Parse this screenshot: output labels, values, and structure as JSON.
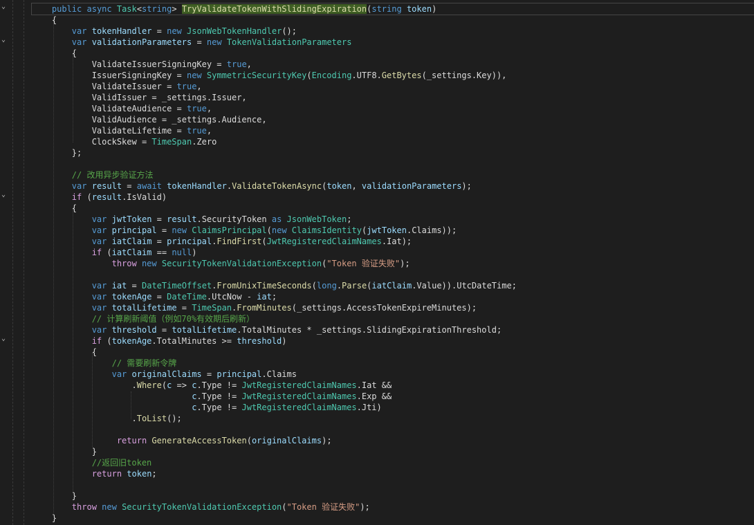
{
  "editor": {
    "language": "C#",
    "theme_colors": {
      "background": "#1e1e1e",
      "keyword": "#569cd6",
      "type": "#4ec9b0",
      "method": "#dcdcaa",
      "comment": "#57a64a",
      "string": "#d69d85",
      "identifier": "#9cdcfe",
      "plain": "#dcdcdc",
      "highlight": "#3f5e24"
    },
    "highlighted_symbol": "TryValidateTokenWithSlidingExpiration",
    "lines": [
      [
        [
          "    ",
          "pl"
        ],
        [
          "public",
          "kw"
        ],
        [
          " ",
          "pl"
        ],
        [
          "async",
          "kw"
        ],
        [
          " ",
          "pl"
        ],
        [
          "Task",
          "ty"
        ],
        [
          "<",
          "pl"
        ],
        [
          "string",
          "kw"
        ],
        [
          "> ",
          "pl"
        ],
        [
          "TryValidateTokenWithSlidingExpiration",
          "hl"
        ],
        [
          "(",
          "pl"
        ],
        [
          "string",
          "kw"
        ],
        [
          " ",
          "pl"
        ],
        [
          "token",
          "id"
        ],
        [
          ")",
          "pl"
        ]
      ],
      [
        [
          "    {",
          "pl"
        ]
      ],
      [
        [
          "        ",
          "pl"
        ],
        [
          "var",
          "kw"
        ],
        [
          " ",
          "pl"
        ],
        [
          "tokenHandler",
          "id"
        ],
        [
          " = ",
          "pl"
        ],
        [
          "new",
          "kw"
        ],
        [
          " ",
          "pl"
        ],
        [
          "JsonWebTokenHandler",
          "ty"
        ],
        [
          "();",
          "pl"
        ]
      ],
      [
        [
          "        ",
          "pl"
        ],
        [
          "var",
          "kw"
        ],
        [
          " ",
          "pl"
        ],
        [
          "validationParameters",
          "id"
        ],
        [
          " = ",
          "pl"
        ],
        [
          "new",
          "kw"
        ],
        [
          " ",
          "pl"
        ],
        [
          "TokenValidationParameters",
          "ty"
        ]
      ],
      [
        [
          "        {",
          "pl"
        ]
      ],
      [
        [
          "            ValidateIssuerSigningKey = ",
          "pl"
        ],
        [
          "true",
          "kw"
        ],
        [
          ",",
          "pl"
        ]
      ],
      [
        [
          "            IssuerSigningKey = ",
          "pl"
        ],
        [
          "new",
          "kw"
        ],
        [
          " ",
          "pl"
        ],
        [
          "SymmetricSecurityKey",
          "ty"
        ],
        [
          "(",
          "pl"
        ],
        [
          "Encoding",
          "ty"
        ],
        [
          ".UTF8.",
          "pl"
        ],
        [
          "GetBytes",
          "fn"
        ],
        [
          "(_settings.Key)),",
          "pl"
        ]
      ],
      [
        [
          "            ValidateIssuer = ",
          "pl"
        ],
        [
          "true",
          "kw"
        ],
        [
          ",",
          "pl"
        ]
      ],
      [
        [
          "            ValidIssuer = _settings.Issuer,",
          "pl"
        ]
      ],
      [
        [
          "            ValidateAudience = ",
          "pl"
        ],
        [
          "true",
          "kw"
        ],
        [
          ",",
          "pl"
        ]
      ],
      [
        [
          "            ValidAudience = _settings.Audience,",
          "pl"
        ]
      ],
      [
        [
          "            ValidateLifetime = ",
          "pl"
        ],
        [
          "true",
          "kw"
        ],
        [
          ",",
          "pl"
        ]
      ],
      [
        [
          "            ClockSkew = ",
          "pl"
        ],
        [
          "TimeSpan",
          "ty"
        ],
        [
          ".Zero",
          "pl"
        ]
      ],
      [
        [
          "        };",
          "pl"
        ]
      ],
      [
        [
          "",
          "pl"
        ]
      ],
      [
        [
          "        ",
          "pl"
        ],
        [
          "// 改用异步验证方法",
          "cm"
        ]
      ],
      [
        [
          "        ",
          "pl"
        ],
        [
          "var",
          "kw"
        ],
        [
          " ",
          "pl"
        ],
        [
          "result",
          "id"
        ],
        [
          " = ",
          "pl"
        ],
        [
          "await",
          "kw"
        ],
        [
          " ",
          "pl"
        ],
        [
          "tokenHandler",
          "id"
        ],
        [
          ".",
          "pl"
        ],
        [
          "ValidateTokenAsync",
          "fn"
        ],
        [
          "(",
          "pl"
        ],
        [
          "token",
          "id"
        ],
        [
          ", ",
          "pl"
        ],
        [
          "validationParameters",
          "id"
        ],
        [
          ");",
          "pl"
        ]
      ],
      [
        [
          "        ",
          "pl"
        ],
        [
          "if",
          "kw2"
        ],
        [
          " (",
          "pl"
        ],
        [
          "result",
          "id"
        ],
        [
          ".IsValid)",
          "pl"
        ]
      ],
      [
        [
          "        {",
          "pl"
        ]
      ],
      [
        [
          "            ",
          "pl"
        ],
        [
          "var",
          "kw"
        ],
        [
          " ",
          "pl"
        ],
        [
          "jwtToken",
          "id"
        ],
        [
          " = ",
          "pl"
        ],
        [
          "result",
          "id"
        ],
        [
          ".SecurityToken ",
          "pl"
        ],
        [
          "as",
          "kw"
        ],
        [
          " ",
          "pl"
        ],
        [
          "JsonWebToken",
          "ty"
        ],
        [
          ";",
          "pl"
        ]
      ],
      [
        [
          "            ",
          "pl"
        ],
        [
          "var",
          "kw"
        ],
        [
          " ",
          "pl"
        ],
        [
          "principal",
          "id"
        ],
        [
          " = ",
          "pl"
        ],
        [
          "new",
          "kw"
        ],
        [
          " ",
          "pl"
        ],
        [
          "ClaimsPrincipal",
          "ty"
        ],
        [
          "(",
          "pl"
        ],
        [
          "new",
          "kw"
        ],
        [
          " ",
          "pl"
        ],
        [
          "ClaimsIdentity",
          "ty"
        ],
        [
          "(",
          "pl"
        ],
        [
          "jwtToken",
          "id"
        ],
        [
          ".Claims));",
          "pl"
        ]
      ],
      [
        [
          "            ",
          "pl"
        ],
        [
          "var",
          "kw"
        ],
        [
          " ",
          "pl"
        ],
        [
          "iatClaim",
          "id"
        ],
        [
          " = ",
          "pl"
        ],
        [
          "principal",
          "id"
        ],
        [
          ".",
          "pl"
        ],
        [
          "FindFirst",
          "fn"
        ],
        [
          "(",
          "pl"
        ],
        [
          "JwtRegisteredClaimNames",
          "ty"
        ],
        [
          ".Iat);",
          "pl"
        ]
      ],
      [
        [
          "            ",
          "pl"
        ],
        [
          "if",
          "kw2"
        ],
        [
          " (",
          "pl"
        ],
        [
          "iatClaim",
          "id"
        ],
        [
          " == ",
          "pl"
        ],
        [
          "null",
          "kw"
        ],
        [
          ")",
          "pl"
        ]
      ],
      [
        [
          "                ",
          "pl"
        ],
        [
          "throw",
          "kw2"
        ],
        [
          " ",
          "pl"
        ],
        [
          "new",
          "kw"
        ],
        [
          " ",
          "pl"
        ],
        [
          "SecurityTokenValidationException",
          "ty"
        ],
        [
          "(",
          "pl"
        ],
        [
          "\"Token 验证失败\"",
          "st"
        ],
        [
          ");",
          "pl"
        ]
      ],
      [
        [
          "",
          "pl"
        ]
      ],
      [
        [
          "            ",
          "pl"
        ],
        [
          "var",
          "kw"
        ],
        [
          " ",
          "pl"
        ],
        [
          "iat",
          "id"
        ],
        [
          " = ",
          "pl"
        ],
        [
          "DateTimeOffset",
          "ty"
        ],
        [
          ".",
          "pl"
        ],
        [
          "FromUnixTimeSeconds",
          "fn"
        ],
        [
          "(",
          "pl"
        ],
        [
          "long",
          "kw"
        ],
        [
          ".",
          "pl"
        ],
        [
          "Parse",
          "fn"
        ],
        [
          "(",
          "pl"
        ],
        [
          "iatClaim",
          "id"
        ],
        [
          ".Value)).UtcDateTime;",
          "pl"
        ]
      ],
      [
        [
          "            ",
          "pl"
        ],
        [
          "var",
          "kw"
        ],
        [
          " ",
          "pl"
        ],
        [
          "tokenAge",
          "id"
        ],
        [
          " = ",
          "pl"
        ],
        [
          "DateTime",
          "ty"
        ],
        [
          ".UtcNow - ",
          "pl"
        ],
        [
          "iat",
          "id"
        ],
        [
          ";",
          "pl"
        ]
      ],
      [
        [
          "            ",
          "pl"
        ],
        [
          "var",
          "kw"
        ],
        [
          " ",
          "pl"
        ],
        [
          "totalLifetime",
          "id"
        ],
        [
          " = ",
          "pl"
        ],
        [
          "TimeSpan",
          "ty"
        ],
        [
          ".",
          "pl"
        ],
        [
          "FromMinutes",
          "fn"
        ],
        [
          "(_settings.AccessTokenExpireMinutes);",
          "pl"
        ]
      ],
      [
        [
          "            ",
          "pl"
        ],
        [
          "// 计算刷新阈值（例如70%有效期后刷新）",
          "cm"
        ]
      ],
      [
        [
          "            ",
          "pl"
        ],
        [
          "var",
          "kw"
        ],
        [
          " ",
          "pl"
        ],
        [
          "threshold",
          "id"
        ],
        [
          " = ",
          "pl"
        ],
        [
          "totalLifetime",
          "id"
        ],
        [
          ".TotalMinutes * _settings.SlidingExpirationThreshold;",
          "pl"
        ]
      ],
      [
        [
          "            ",
          "pl"
        ],
        [
          "if",
          "kw2"
        ],
        [
          " (",
          "pl"
        ],
        [
          "tokenAge",
          "id"
        ],
        [
          ".TotalMinutes >= ",
          "pl"
        ],
        [
          "threshold",
          "id"
        ],
        [
          ")",
          "pl"
        ]
      ],
      [
        [
          "            {",
          "pl"
        ]
      ],
      [
        [
          "                ",
          "pl"
        ],
        [
          "// 需要刷新令牌",
          "cm"
        ]
      ],
      [
        [
          "                ",
          "pl"
        ],
        [
          "var",
          "kw"
        ],
        [
          " ",
          "pl"
        ],
        [
          "originalClaims",
          "id"
        ],
        [
          " = ",
          "pl"
        ],
        [
          "principal",
          "id"
        ],
        [
          ".Claims",
          "pl"
        ]
      ],
      [
        [
          "                    .",
          "pl"
        ],
        [
          "Where",
          "fn"
        ],
        [
          "(",
          "pl"
        ],
        [
          "c",
          "id"
        ],
        [
          " => ",
          "pl"
        ],
        [
          "c",
          "id"
        ],
        [
          ".Type != ",
          "pl"
        ],
        [
          "JwtRegisteredClaimNames",
          "ty"
        ],
        [
          ".Iat &&",
          "pl"
        ]
      ],
      [
        [
          "                                ",
          "pl"
        ],
        [
          "c",
          "id"
        ],
        [
          ".Type != ",
          "pl"
        ],
        [
          "JwtRegisteredClaimNames",
          "ty"
        ],
        [
          ".Exp &&",
          "pl"
        ]
      ],
      [
        [
          "                                ",
          "pl"
        ],
        [
          "c",
          "id"
        ],
        [
          ".Type != ",
          "pl"
        ],
        [
          "JwtRegisteredClaimNames",
          "ty"
        ],
        [
          ".Jti)",
          "pl"
        ]
      ],
      [
        [
          "                    .",
          "pl"
        ],
        [
          "ToList",
          "fn"
        ],
        [
          "();",
          "pl"
        ]
      ],
      [
        [
          "",
          "pl"
        ]
      ],
      [
        [
          "                 ",
          "pl"
        ],
        [
          "return",
          "kw2"
        ],
        [
          " ",
          "pl"
        ],
        [
          "GenerateAccessToken",
          "fn"
        ],
        [
          "(",
          "pl"
        ],
        [
          "originalClaims",
          "id"
        ],
        [
          ");",
          "pl"
        ]
      ],
      [
        [
          "            }",
          "pl"
        ]
      ],
      [
        [
          "            ",
          "pl"
        ],
        [
          "//返回旧token",
          "cm"
        ]
      ],
      [
        [
          "            ",
          "pl"
        ],
        [
          "return",
          "kw2"
        ],
        [
          " ",
          "pl"
        ],
        [
          "token",
          "id"
        ],
        [
          ";",
          "pl"
        ]
      ],
      [
        [
          "",
          "pl"
        ]
      ],
      [
        [
          "        }",
          "pl"
        ]
      ],
      [
        [
          "        ",
          "pl"
        ],
        [
          "throw",
          "kw2"
        ],
        [
          " ",
          "pl"
        ],
        [
          "new",
          "kw"
        ],
        [
          " ",
          "pl"
        ],
        [
          "SecurityTokenValidationException",
          "ty"
        ],
        [
          "(",
          "pl"
        ],
        [
          "\"Token 验证失败\"",
          "st"
        ],
        [
          ");",
          "pl"
        ]
      ],
      [
        [
          "    }",
          "pl"
        ]
      ]
    ]
  }
}
